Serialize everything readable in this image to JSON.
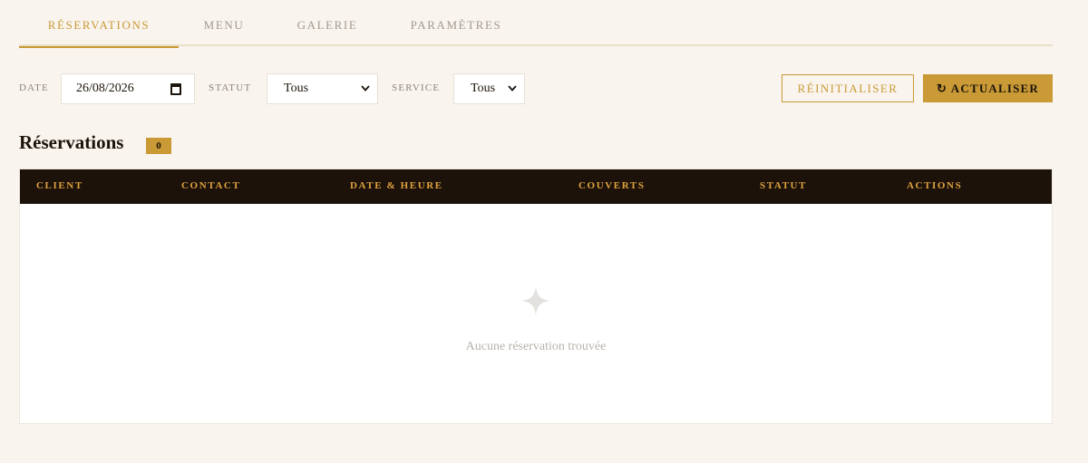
{
  "tabs": [
    {
      "label": "RÉSERVATIONS",
      "active": true
    },
    {
      "label": "MENU",
      "active": false
    },
    {
      "label": "GALERIE",
      "active": false
    },
    {
      "label": "PARAMÈTRES",
      "active": false
    }
  ],
  "filters": {
    "date_label": "DATE",
    "date_value": "26/08/2026",
    "statut_label": "STATUT",
    "statut_value": "Tous",
    "service_label": "SERVICE",
    "service_value": "Tous",
    "reset_label": "RÉINITIALISER",
    "refresh_label": "↻ ACTUALISER"
  },
  "section": {
    "title": "Réservations",
    "count": "0"
  },
  "table": {
    "columns": [
      "CLIENT",
      "CONTACT",
      "DATE & HEURE",
      "COUVERTS",
      "STATUT",
      "ACTIONS"
    ],
    "empty_text": "Aucune réservation trouvée"
  },
  "colors": {
    "accent": "#c99a35",
    "header_bg": "#1c120a",
    "page_bg": "#f9f4ee"
  }
}
